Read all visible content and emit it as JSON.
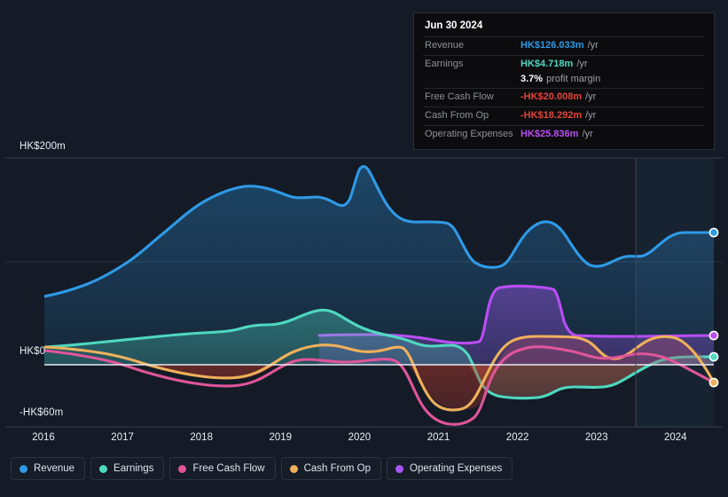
{
  "tooltip": {
    "date": "Jun 30 2024",
    "rows": [
      {
        "key": "Revenue",
        "value": "HK$126.033m",
        "unit": "/yr",
        "color": "#2f9ae8"
      },
      {
        "key": "Earnings",
        "value": "HK$4.718m",
        "unit": "/yr",
        "color": "#4fd8c0"
      },
      {
        "key": "Free Cash Flow",
        "value": "-HK$20.008m",
        "unit": "/yr",
        "color": "#e0453a"
      },
      {
        "key": "Cash From Op",
        "value": "-HK$18.292m",
        "unit": "/yr",
        "color": "#e0453a"
      },
      {
        "key": "Operating Expenses",
        "value": "HK$25.836m",
        "unit": "/yr",
        "color": "#bb4df5"
      }
    ],
    "margin_value": "3.7%",
    "margin_label": "profit margin"
  },
  "legend": [
    {
      "label": "Revenue",
      "color": "#2f9ae8"
    },
    {
      "label": "Earnings",
      "color": "#4fd8c0"
    },
    {
      "label": "Free Cash Flow",
      "color": "#e0559a"
    },
    {
      "label": "Cash From Op",
      "color": "#efb15b"
    },
    {
      "label": "Operating Expenses",
      "color": "#a855f7"
    }
  ],
  "axes": {
    "y_top": "HK$200m",
    "y_zero": "HK$0",
    "y_bottom": "-HK$60m",
    "x_ticks": [
      "2016",
      "2017",
      "2018",
      "2019",
      "2020",
      "2021",
      "2022",
      "2023",
      "2024"
    ]
  },
  "chart_data": {
    "type": "area",
    "title": "",
    "xlabel": "",
    "ylabel": "HK$",
    "ylim": [
      -60,
      200
    ],
    "y_ticks": [
      200,
      100,
      0,
      -60
    ],
    "grid": true,
    "legend_position": "bottom",
    "x": [
      2015.9,
      2016.2,
      2016.5,
      2016.8,
      2017.1,
      2017.4,
      2017.7,
      2018.0,
      2018.3,
      2018.6,
      2018.9,
      2019.2,
      2019.5,
      2019.8,
      2020.1,
      2020.4,
      2020.7,
      2021.0,
      2021.3,
      2021.6,
      2021.9,
      2022.2,
      2022.5,
      2022.8,
      2023.1,
      2023.4,
      2023.7,
      2024.0,
      2024.5
    ],
    "series": [
      {
        "name": "Revenue",
        "color": "#2f9ae8",
        "values": [
          66,
          70,
          74,
          80,
          88,
          99,
          112,
          128,
          146,
          160,
          167,
          163,
          160,
          140,
          175,
          190,
          172,
          152,
          152,
          128,
          122,
          155,
          140,
          124,
          112,
          118,
          110,
          122,
          126.033
        ],
        "end_label": "HK$126.033m"
      },
      {
        "name": "Earnings",
        "color": "#4fd8c0",
        "values": [
          17,
          18,
          19,
          21,
          23,
          25,
          27,
          29,
          30,
          27,
          25,
          25,
          30,
          33,
          30,
          25,
          20,
          18,
          22,
          22,
          -17,
          -19,
          -22,
          -8,
          -10,
          -11,
          -8,
          2,
          4.718
        ],
        "end_label": "HK$4.718m"
      },
      {
        "name": "Free Cash Flow",
        "color": "#e0559a",
        "values": [
          14,
          12,
          9,
          5,
          0,
          -5,
          -11,
          -16,
          -18,
          -17,
          -13,
          -7,
          -2,
          2,
          6,
          8,
          6,
          -4,
          -22,
          -44,
          -48,
          -17,
          -10,
          -9,
          -8,
          -4,
          2,
          -11,
          -20.008
        ],
        "end_label": "-HK$20.008m"
      },
      {
        "name": "Cash From Op",
        "color": "#efb15b",
        "values": [
          17,
          14,
          10,
          6,
          1,
          -4,
          -9,
          -14,
          -16,
          -14,
          -9,
          -2,
          6,
          12,
          16,
          17,
          14,
          2,
          -18,
          -40,
          -42,
          10,
          12,
          11,
          4,
          7,
          11,
          0,
          -18.292
        ],
        "end_label": "-HK$18.292m"
      },
      {
        "name": "Operating Expenses",
        "color": "#a855f7",
        "values": [
          null,
          null,
          null,
          null,
          null,
          null,
          null,
          null,
          null,
          null,
          null,
          28,
          28,
          27,
          26,
          25,
          24,
          23,
          24,
          24,
          74,
          74,
          72,
          26,
          26,
          26,
          26,
          26,
          25.836
        ],
        "end_label": "HK$25.836m"
      }
    ],
    "forecast_divider_x": 2023.55
  }
}
